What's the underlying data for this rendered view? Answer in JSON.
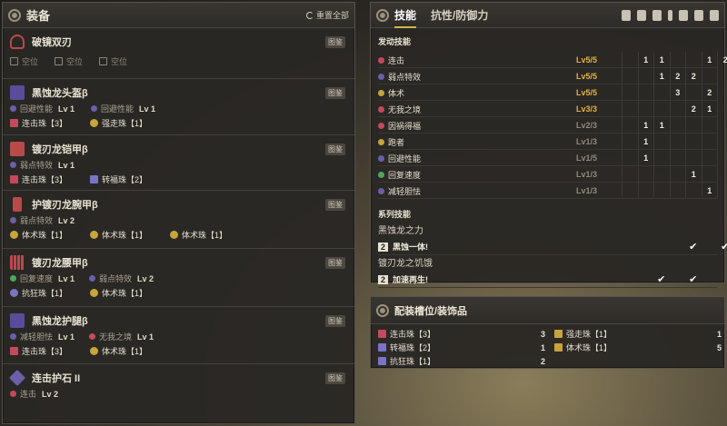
{
  "equipment": {
    "title": "装备",
    "reset_label": "重置全部",
    "badge": "图鉴",
    "weapon": {
      "name": "破镜双刃",
      "slots": [
        "空位",
        "空位",
        "空位"
      ]
    },
    "armor": [
      {
        "name": "黑蚀龙头盔β",
        "skills": [
          {
            "name": "回避性能",
            "lv": "Lv 1",
            "color": "#6b5fa8"
          },
          {
            "name": "回避性能",
            "lv": "Lv 1",
            "color": "#6b5fa8"
          }
        ],
        "decos": [
          {
            "name": "连击珠【3】",
            "color": "#c44a5b"
          },
          {
            "name": "强走珠【1】",
            "color": "#c9a43a"
          }
        ]
      },
      {
        "name": "镀刃龙铠甲β",
        "skills": [
          {
            "name": "弱点特效",
            "lv": "Lv 1",
            "color": "#6b5fa8"
          }
        ],
        "decos": [
          {
            "name": "连击珠【3】",
            "color": "#c44a5b"
          },
          {
            "name": "转福珠【2】",
            "color": "#7a74c4"
          }
        ]
      },
      {
        "name": "护镀刃龙腕甲β",
        "skills": [
          {
            "name": "弱点特效",
            "lv": "Lv 2",
            "color": "#6b5fa8"
          }
        ],
        "decos": [
          {
            "name": "体术珠【1】",
            "color": "#c9a43a"
          },
          {
            "name": "体术珠【1】",
            "color": "#c9a43a"
          },
          {
            "name": "体术珠【1】",
            "color": "#c9a43a"
          }
        ]
      },
      {
        "name": "镀刃龙腰甲β",
        "skills": [
          {
            "name": "回复速度",
            "lv": "Lv 1",
            "color": "#4fa85a"
          },
          {
            "name": "弱点特效",
            "lv": "Lv 2",
            "color": "#6b5fa8"
          }
        ],
        "decos": [
          {
            "name": "抗狂珠【1】",
            "color": "#7a74c4"
          },
          {
            "name": "体术珠【1】",
            "color": "#c9a43a"
          }
        ]
      },
      {
        "name": "黑蚀龙护腿β",
        "skills": [
          {
            "name": "减轻胆怯",
            "lv": "Lv 1",
            "color": "#6b5fa8"
          },
          {
            "name": "无我之境",
            "lv": "Lv 1",
            "color": "#c44a5b"
          }
        ],
        "decos": [
          {
            "name": "连击珠【3】",
            "color": "#c44a5b"
          },
          {
            "name": "体术珠【1】",
            "color": "#c9a43a"
          }
        ]
      }
    ],
    "charm": {
      "name": "连击护石 II",
      "skill": "连击",
      "lv": "Lv 2"
    }
  },
  "skills_panel": {
    "tabs": [
      "技能",
      "抗性/防御力"
    ],
    "active_label": "发动技能",
    "skills": [
      {
        "name": "连击",
        "lv": "Lv5/5",
        "max": true,
        "color": "#c44a5b",
        "cells": [
          "",
          "1",
          "1",
          "",
          "",
          "1",
          "2"
        ]
      },
      {
        "name": "弱点特效",
        "lv": "Lv5/5",
        "max": true,
        "color": "#6b5fa8",
        "cells": [
          "",
          "",
          "1",
          "2",
          "2",
          "",
          ""
        ]
      },
      {
        "name": "体术",
        "lv": "Lv5/5",
        "max": true,
        "color": "#c9a43a",
        "cells": [
          "",
          "",
          "",
          "3",
          "",
          "2",
          ""
        ]
      },
      {
        "name": "无我之境",
        "lv": "Lv3/3",
        "max": true,
        "color": "#c44a5b",
        "cells": [
          "",
          "",
          "",
          "",
          "2",
          "1",
          ""
        ]
      },
      {
        "name": "因祸得福",
        "lv": "Lv2/3",
        "max": false,
        "color": "#c44a5b",
        "cells": [
          "",
          "1",
          "1",
          "",
          "",
          "",
          ""
        ]
      },
      {
        "name": "跑者",
        "lv": "Lv1/3",
        "max": false,
        "color": "#c9a43a",
        "cells": [
          "",
          "1",
          "",
          "",
          "",
          "",
          ""
        ]
      },
      {
        "name": "回避性能",
        "lv": "Lv1/5",
        "max": false,
        "color": "#6b5fa8",
        "cells": [
          "",
          "1",
          "",
          "",
          "",
          "",
          ""
        ]
      },
      {
        "name": "回复速度",
        "lv": "Lv1/3",
        "max": false,
        "color": "#4fa85a",
        "cells": [
          "",
          "",
          "",
          "",
          "1",
          "",
          ""
        ]
      },
      {
        "name": "减轻胆怯",
        "lv": "Lv1/3",
        "max": false,
        "color": "#6b5fa8",
        "cells": [
          "",
          "",
          "",
          "",
          "",
          "1",
          ""
        ]
      }
    ],
    "series_label": "系列技能",
    "series": [
      {
        "group": "黑蚀龙之力",
        "count": "2",
        "name": "黑蚀一体!",
        "checks": [
          false,
          false,
          false,
          false,
          true,
          false,
          true
        ]
      },
      {
        "group": "镀刃龙之饥饿",
        "count": "2",
        "name": "加速再生!",
        "checks": [
          false,
          false,
          true,
          false,
          true,
          false,
          false
        ]
      }
    ]
  },
  "deco_panel": {
    "title": "配装槽位/装饰品",
    "items": [
      {
        "name": "连击珠【3】",
        "count": "3",
        "color": "#c44a5b"
      },
      {
        "name": "强走珠【1】",
        "count": "1",
        "color": "#c9a43a"
      },
      {
        "name": "转福珠【2】",
        "count": "1",
        "color": "#7a74c4"
      },
      {
        "name": "体术珠【1】",
        "count": "5",
        "color": "#c9a43a"
      },
      {
        "name": "抗狂珠【1】",
        "count": "2",
        "color": "#7a74c4"
      }
    ]
  }
}
